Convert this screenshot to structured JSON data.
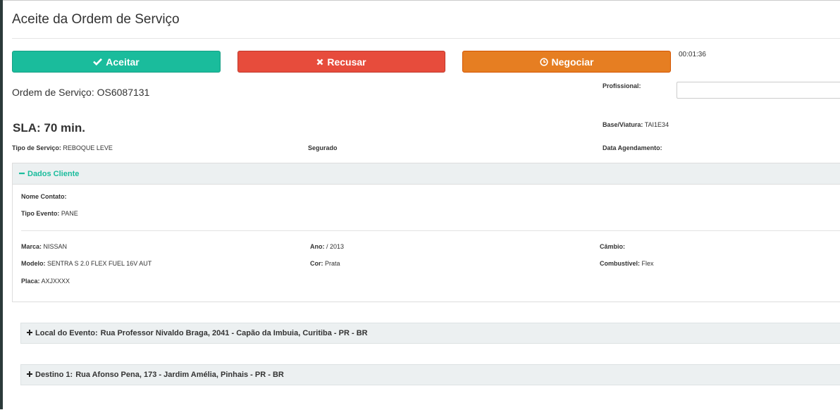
{
  "modal": {
    "title": "Aceite da Ordem de Serviço",
    "timer": "00:01:36"
  },
  "actions": {
    "accept_label": "Aceitar",
    "refuse_label": "Recusar",
    "negotiate_label": "Negociar"
  },
  "order": {
    "os_label": "Ordem de Serviço:",
    "os_value": "OS6087131",
    "sla": "SLA: 70 min.",
    "tipo_servico_label": "Tipo de Serviço:",
    "tipo_servico_value": "REBOQUE LEVE",
    "segurado_label": "Segurado",
    "profissional_label": "Profissional:",
    "profissional_value": "",
    "base_viatura_label": "Base/Viatura:",
    "base_viatura_value": "TAI1E34",
    "data_agendamento_label": "Data Agendamento:"
  },
  "client_panel": {
    "title": "Dados Cliente",
    "nome_contato_label": "Nome Contato:",
    "tipo_evento_label": "Tipo Evento:",
    "tipo_evento_value": "PANE",
    "marca_label": "Marca:",
    "marca_value": "NISSAN",
    "ano_label": "Ano:",
    "ano_value": "/ 2013",
    "cambio_label": "Câmbio:",
    "modelo_label": "Modelo:",
    "modelo_value": "SENTRA S 2.0 FLEX FUEL 16V AUT",
    "cor_label": "Cor:",
    "cor_value": "Prata",
    "combustivel_label": "Combustível:",
    "combustivel_value": "Flex",
    "placa_label": "Placa:",
    "placa_value": "AXJXXXX"
  },
  "locations": {
    "local_label": "Local do Evento:",
    "local_value": "Rua Professor Nivaldo Braga, 2041 - Capão da Imbuia, Curitiba - PR - BR",
    "destino_label": "Destino 1:",
    "destino_value": "Rua Afonso Pena, 173 - Jardim Amélia, Pinhais - PR - BR"
  },
  "icons": {
    "accept": "check-icon",
    "refuse": "times-icon",
    "negotiate": "clock-circle-icon",
    "collapse": "minus-icon",
    "expand": "plus-icon"
  },
  "colors": {
    "accept": "#1abc9c",
    "refuse": "#e74c3c",
    "negotiate": "#e67e22",
    "panel_header": "#ecf0f1"
  }
}
